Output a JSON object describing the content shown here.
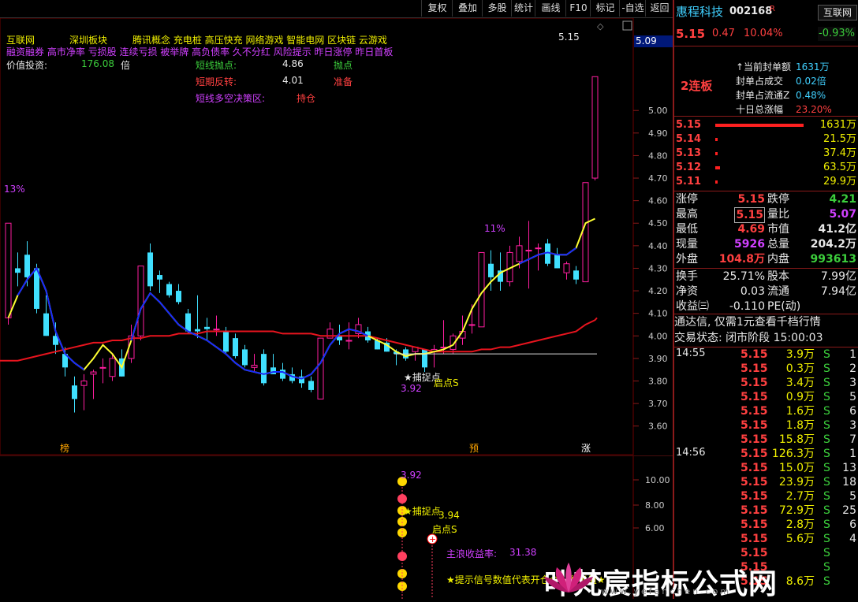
{
  "toolbar": {
    "buttons": [
      "复权",
      "叠加",
      "多股",
      "统计",
      "画线",
      "F10",
      "标记",
      "-自选",
      "返回"
    ]
  },
  "stock": {
    "name": "惠程科技",
    "code": "002168",
    "flag": "R",
    "sector": "互联网",
    "sector_change": "-0.93%",
    "price": "5.15",
    "change": "0.47",
    "pct": "10.04%"
  },
  "limit_info": {
    "badge": "2连板",
    "rows": [
      {
        "label": "当前封单额",
        "value": "1631万"
      },
      {
        "label": "封单占成交",
        "value": "0.02倍"
      },
      {
        "label": "封单占流通Z",
        "value": "0.48%"
      },
      {
        "label": "十日总涨幅",
        "value": "23.20%"
      }
    ]
  },
  "order_book": [
    {
      "price": "5.15",
      "vol": "1631万",
      "bar": 1.0
    },
    {
      "price": "5.14",
      "vol": "21.5万",
      "bar": 0.02
    },
    {
      "price": "5.13",
      "vol": "37.4万",
      "bar": 0.03
    },
    {
      "price": "5.12",
      "vol": "63.5万",
      "bar": 0.05
    },
    {
      "price": "5.11",
      "vol": "29.9万",
      "bar": 0.02
    }
  ],
  "quote": [
    {
      "l1": "涨停",
      "v1": "5.15",
      "c1": "red",
      "l2": "跌停",
      "v2": "4.21",
      "c2": "green"
    },
    {
      "l1": "最高",
      "v1": "5.15",
      "c1": "red",
      "l2": "量比",
      "v2": "5.07",
      "c2": "purple"
    },
    {
      "l1": "最低",
      "v1": "4.69",
      "c1": "red",
      "l2": "市值",
      "v2": "41.2亿",
      "c2": "white"
    },
    {
      "l1": "现量",
      "v1": "5926",
      "c1": "purple",
      "l2": "总量",
      "v2": "204.2万",
      "c2": "white"
    },
    {
      "l1": "外盘",
      "v1": "104.8万",
      "c1": "red",
      "l2": "内盘",
      "v2": "993613",
      "c2": "green"
    }
  ],
  "fundamentals": [
    {
      "l1": "换手",
      "v1": "25.71%",
      "l2": "股本",
      "v2": "7.99亿"
    },
    {
      "l1": "净资",
      "v1": "0.03",
      "l2": "流通",
      "v2": "7.94亿"
    },
    {
      "l1": "收益㈢",
      "v1": "-0.110",
      "l2": "PE(动)",
      "v2": ""
    }
  ],
  "notice": "通达信, 仅需1元查看千档行情",
  "trade_status": "交易状态: 闭市阶段 15:00:03",
  "ticks_1455": {
    "time": "14:55",
    "rows": [
      {
        "p": "5.15",
        "v": "3.9万",
        "s": "S",
        "n": "1"
      },
      {
        "p": "5.15",
        "v": "0.3万",
        "s": "S",
        "n": "2"
      },
      {
        "p": "5.15",
        "v": "3.4万",
        "s": "S",
        "n": "3"
      },
      {
        "p": "5.15",
        "v": "0.9万",
        "s": "S",
        "n": "5"
      },
      {
        "p": "5.15",
        "v": "1.6万",
        "s": "S",
        "n": "6"
      },
      {
        "p": "5.15",
        "v": "1.8万",
        "s": "S",
        "n": "3"
      },
      {
        "p": "5.15",
        "v": "15.8万",
        "s": "S",
        "n": "7"
      }
    ]
  },
  "ticks_1456": {
    "time": "14:56",
    "rows": [
      {
        "p": "5.15",
        "v": "126.3万",
        "s": "S",
        "n": "1"
      },
      {
        "p": "5.15",
        "v": "15.0万",
        "s": "S",
        "n": "13"
      },
      {
        "p": "5.15",
        "v": "23.9万",
        "s": "S",
        "n": "18"
      },
      {
        "p": "5.15",
        "v": "2.7万",
        "s": "S",
        "n": "5"
      },
      {
        "p": "5.15",
        "v": "72.9万",
        "s": "S",
        "n": "25"
      },
      {
        "p": "5.15",
        "v": "2.8万",
        "s": "S",
        "n": "6"
      },
      {
        "p": "5.15",
        "v": "5.6万",
        "s": "S",
        "n": "4"
      },
      {
        "p": "5.15",
        "v": "",
        "s": "S",
        "n": ""
      },
      {
        "p": "5.15",
        "v": "",
        "s": "S",
        "n": ""
      },
      {
        "p": "5.15",
        "v": "8.6万",
        "s": "S",
        "n": ""
      }
    ]
  },
  "chart_header": {
    "line1": [
      "互联网",
      "深圳板块",
      "腾讯概念 充电桩 高压快充 网络游戏 智能电网 区块链 云游戏"
    ],
    "line2": "融资融券 高市净率 亏损股 连续亏损 被举牌 高负债率 久不分红 风险提示 昨日涨停 昨日首板",
    "value_label": "价值投资:",
    "value_num": "176.08",
    "value_unit": "倍",
    "signals": [
      {
        "label": "短线抛点:",
        "value": "4.86",
        "tag": "抛点",
        "lc": "#3ccf3c",
        "vc": "#e8e8e8",
        "tc": "#3ccf3c"
      },
      {
        "label": "短期反转:",
        "value": "4.01",
        "tag": "准备",
        "lc": "#ff4040",
        "vc": "#e8e8e8",
        "tc": "#ff4040"
      },
      {
        "label": "短线多空决策区:",
        "value": "",
        "tag": "持仓",
        "lc": "#d040ff",
        "vc": "#e8e8e8",
        "tc": "#ff4040"
      }
    ]
  },
  "chart_annotations": {
    "top_price": "5.15",
    "pct_13": "13%",
    "pct_11": "11%",
    "capture": "★捕捉点",
    "capture_price": "3.92",
    "start": "启点S",
    "marker_bang": "榜",
    "marker_yu": "预",
    "marker_zhang": "涨",
    "sub_capture_price": "3.92",
    "sub_start_price": "3.94",
    "sub_capture": "★捕捉点",
    "sub_start": "启点S",
    "sub_yield_label": "主浪收益率:",
    "sub_yield_value": "31.38",
    "sub_hint": "★提示信号数值代表开仓介入参考值★"
  },
  "watermark": {
    "text": "叶梵宸指标公式网",
    "url": "www.yefanchen.com"
  },
  "colors": {
    "up": "#ff1ea0",
    "down": "#40e0ff",
    "ma_slow": "#e8141e",
    "ma_fast_blue": "#1428ff",
    "ma_fast_yellow": "#ffff32",
    "grid": "#6b0000"
  },
  "chart_data": {
    "type": "candlestick",
    "y_axis_ticks": [
      "5.00",
      "4.90",
      "4.80",
      "4.70",
      "4.60",
      "4.50",
      "4.40",
      "4.30",
      "4.20",
      "4.10",
      "4.00",
      "3.90",
      "3.80",
      "3.70",
      "3.60"
    ],
    "y_axis_current": "5.09",
    "ylim": [
      3.55,
      5.2
    ],
    "sub_y_axis_ticks": [
      "10.00",
      "8.00",
      "6.00"
    ],
    "candles": [
      {
        "o": 4.08,
        "h": 4.5,
        "l": 4.05,
        "c": 4.5
      },
      {
        "o": 4.3,
        "h": 4.37,
        "l": 4.22,
        "c": 4.28
      },
      {
        "o": 4.36,
        "h": 4.42,
        "l": 4.22,
        "c": 4.26
      },
      {
        "o": 4.3,
        "h": 4.32,
        "l": 4.1,
        "c": 4.12
      },
      {
        "o": 4.1,
        "h": 4.18,
        "l": 4.0,
        "c": 4.0
      },
      {
        "o": 4.0,
        "h": 4.06,
        "l": 3.92,
        "c": 3.96
      },
      {
        "o": 3.92,
        "h": 3.95,
        "l": 3.82,
        "c": 3.86
      },
      {
        "o": 3.78,
        "h": 3.82,
        "l": 3.66,
        "c": 3.72
      },
      {
        "o": 3.78,
        "h": 3.83,
        "l": 3.67,
        "c": 3.8
      },
      {
        "o": 3.83,
        "h": 3.85,
        "l": 3.72,
        "c": 3.84
      },
      {
        "o": 3.86,
        "h": 3.9,
        "l": 3.79,
        "c": 3.86
      },
      {
        "o": 3.82,
        "h": 3.92,
        "l": 3.8,
        "c": 3.9
      },
      {
        "o": 3.9,
        "h": 3.94,
        "l": 3.82,
        "c": 3.82
      },
      {
        "o": 3.9,
        "h": 4.05,
        "l": 3.88,
        "c": 4.0
      },
      {
        "o": 4.0,
        "h": 4.31,
        "l": 3.98,
        "c": 4.31
      },
      {
        "o": 4.37,
        "h": 4.41,
        "l": 4.2,
        "c": 4.22
      },
      {
        "o": 4.27,
        "h": 4.29,
        "l": 4.19,
        "c": 4.25
      },
      {
        "o": 4.23,
        "h": 4.24,
        "l": 4.17,
        "c": 4.18
      },
      {
        "o": 4.2,
        "h": 4.23,
        "l": 4.14,
        "c": 4.15
      },
      {
        "o": 4.1,
        "h": 4.12,
        "l": 4.01,
        "c": 4.02
      },
      {
        "o": 4.03,
        "h": 4.18,
        "l": 3.99,
        "c": 4.02
      },
      {
        "o": 4.04,
        "h": 4.08,
        "l": 3.98,
        "c": 4.03
      },
      {
        "o": 4.03,
        "h": 4.09,
        "l": 4.0,
        "c": 4.03
      },
      {
        "o": 4.02,
        "h": 4.04,
        "l": 3.92,
        "c": 3.93
      },
      {
        "o": 3.99,
        "h": 4.01,
        "l": 3.9,
        "c": 3.91
      },
      {
        "o": 3.94,
        "h": 3.96,
        "l": 3.86,
        "c": 3.87
      },
      {
        "o": 3.86,
        "h": 3.92,
        "l": 3.84,
        "c": 3.87
      },
      {
        "o": 3.92,
        "h": 3.94,
        "l": 3.78,
        "c": 3.79
      },
      {
        "o": 3.86,
        "h": 3.92,
        "l": 3.83,
        "c": 3.83
      },
      {
        "o": 3.85,
        "h": 3.88,
        "l": 3.8,
        "c": 3.81
      },
      {
        "o": 3.83,
        "h": 3.86,
        "l": 3.79,
        "c": 3.8
      },
      {
        "o": 3.82,
        "h": 3.85,
        "l": 3.77,
        "c": 3.79
      },
      {
        "o": 3.8,
        "h": 3.82,
        "l": 3.75,
        "c": 3.76
      },
      {
        "o": 3.72,
        "h": 3.99,
        "l": 3.72,
        "c": 3.99
      },
      {
        "o": 3.99,
        "h": 4.06,
        "l": 3.99,
        "c": 4.03
      },
      {
        "o": 4.0,
        "h": 4.05,
        "l": 3.96,
        "c": 3.98
      },
      {
        "o": 3.98,
        "h": 4.06,
        "l": 3.94,
        "c": 3.98
      },
      {
        "o": 4.01,
        "h": 4.08,
        "l": 3.99,
        "c": 4.05
      },
      {
        "o": 4.02,
        "h": 4.04,
        "l": 3.97,
        "c": 3.98
      },
      {
        "o": 3.98,
        "h": 3.99,
        "l": 3.94,
        "c": 3.94
      },
      {
        "o": 3.97,
        "h": 3.99,
        "l": 3.93,
        "c": 3.93
      },
      {
        "o": 3.93,
        "h": 3.94,
        "l": 3.87,
        "c": 3.92
      },
      {
        "o": 3.94,
        "h": 3.95,
        "l": 3.89,
        "c": 3.9
      },
      {
        "o": 3.93,
        "h": 3.95,
        "l": 3.89,
        "c": 3.95
      },
      {
        "o": 3.94,
        "h": 3.94,
        "l": 3.84,
        "c": 3.86
      },
      {
        "o": 3.93,
        "h": 3.96,
        "l": 3.86,
        "c": 3.94
      },
      {
        "o": 3.95,
        "h": 4.07,
        "l": 3.92,
        "c": 3.95
      },
      {
        "o": 3.94,
        "h": 4.01,
        "l": 3.92,
        "c": 4.0
      },
      {
        "o": 3.99,
        "h": 4.09,
        "l": 3.96,
        "c": 4.02
      },
      {
        "o": 4.05,
        "h": 4.14,
        "l": 4.01,
        "c": 4.05
      },
      {
        "o": 4.04,
        "h": 4.37,
        "l": 4.04,
        "c": 4.37
      },
      {
        "o": 4.32,
        "h": 4.38,
        "l": 4.2,
        "c": 4.26
      },
      {
        "o": 4.29,
        "h": 4.37,
        "l": 4.2,
        "c": 4.24
      },
      {
        "o": 4.24,
        "h": 4.4,
        "l": 4.22,
        "c": 4.37
      },
      {
        "o": 4.33,
        "h": 4.44,
        "l": 4.3,
        "c": 4.4
      },
      {
        "o": 4.38,
        "h": 4.51,
        "l": 4.21,
        "c": 4.38
      },
      {
        "o": 4.39,
        "h": 4.41,
        "l": 4.29,
        "c": 4.39
      },
      {
        "o": 4.41,
        "h": 4.43,
        "l": 4.31,
        "c": 4.32
      },
      {
        "o": 4.36,
        "h": 4.39,
        "l": 4.3,
        "c": 4.3
      },
      {
        "o": 4.28,
        "h": 4.33,
        "l": 4.25,
        "c": 4.32
      },
      {
        "o": 4.29,
        "h": 4.31,
        "l": 4.23,
        "c": 4.25
      },
      {
        "o": 4.24,
        "h": 4.68,
        "l": 4.24,
        "c": 4.68
      },
      {
        "o": 4.7,
        "h": 5.15,
        "l": 4.69,
        "c": 5.15
      }
    ],
    "ma_slow": [
      3.89,
      3.89,
      3.9,
      3.91,
      3.92,
      3.93,
      3.94,
      3.95,
      3.96,
      3.97,
      3.97,
      3.98,
      3.98,
      3.99,
      3.99,
      4.0,
      4.0,
      4.0,
      4.01,
      4.01,
      4.01,
      4.02,
      4.02,
      4.02,
      4.02,
      4.02,
      4.02,
      4.02,
      4.02,
      4.01,
      4.01,
      4.01,
      4.01,
      4.0,
      4.0,
      4.0,
      4.0,
      4.0,
      4.0,
      3.99,
      3.98,
      3.97,
      3.96,
      3.95,
      3.94,
      3.93,
      3.93,
      3.93,
      3.93,
      3.93,
      3.94,
      3.94,
      3.95,
      3.95,
      3.96,
      3.97,
      3.98,
      3.99,
      4.0,
      4.01,
      4.02,
      4.05,
      4.07
    ],
    "ma_fast": [
      4.08,
      4.18,
      4.25,
      4.3,
      4.2,
      4.02,
      3.92,
      3.88,
      3.85,
      3.9,
      3.96,
      3.92,
      3.86,
      3.98,
      4.12,
      4.19,
      4.15,
      4.1,
      4.05,
      4.02,
      4.0,
      3.98,
      3.95,
      3.92,
      3.88,
      3.85,
      3.84,
      3.83,
      3.84,
      3.84,
      3.82,
      3.81,
      3.83,
      3.88,
      3.96,
      4.01,
      4.03,
      4.02,
      4.0,
      3.98,
      3.96,
      3.93,
      3.91,
      3.92,
      3.92,
      3.93,
      3.94,
      3.96,
      4.02,
      4.12,
      4.19,
      4.24,
      4.28,
      4.3,
      4.32,
      4.34,
      4.36,
      4.37,
      4.36,
      4.36,
      4.39,
      4.5,
      4.52
    ],
    "ma_fast_blue_ranges": [
      [
        1,
        8
      ],
      [
        13,
        38
      ],
      [
        54,
        60
      ]
    ]
  }
}
